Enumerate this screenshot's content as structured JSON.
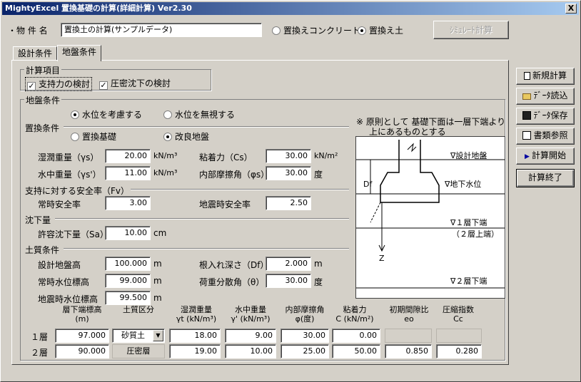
{
  "window": {
    "title": "MightyExcel 置換基礎の計算(詳細計算) Ver2.30",
    "close": "X"
  },
  "header": {
    "name_label": "・物 件 名",
    "name_value": "置換土の計算(サンプルデータ)",
    "radio_concrete": "置換えコンクリート",
    "radio_soil": "置換え土",
    "selected": "置換え土",
    "simulate": "ｼﾐｭﾚｰﾄ計算"
  },
  "tabs": [
    "設計条件",
    "地盤条件"
  ],
  "active_tab": "地盤条件",
  "calc_items": {
    "label": "計算項目",
    "bearing": "支持力の検討",
    "settlement": "圧密沈下の検討"
  },
  "ground": {
    "label": "地盤条件",
    "replace_label": "置換条件",
    "water_consider": "水位を考慮する",
    "water_ignore": "水位を無視する",
    "replace_base": "置換基礎",
    "improved": "改良地盤"
  },
  "params": {
    "gamma_s_label": "湿潤重量（γs）",
    "gamma_s": "20.00",
    "gamma_s_unit": "kN/m³",
    "cs_label": "粘着力（Cs）",
    "cs": "30.00",
    "cs_unit": "kN/m²",
    "gamma_s2_label": "水中重量（γs'）",
    "gamma_s2": "11.00",
    "gamma_s2_unit": "kN/m³",
    "phis_label": "内部摩擦角（φs）",
    "phis": "30.00",
    "phis_unit": "度"
  },
  "safety": {
    "label": "支持に対する安全率（Fv）",
    "normal_label": "常時安全率",
    "normal": "3.00",
    "quake_label": "地震時安全率",
    "quake": "2.50"
  },
  "settle": {
    "label": "沈下量",
    "allow_label": "許容沈下量（Sa）",
    "allow": "10.00",
    "unit": "cm"
  },
  "soil": {
    "label": "土質条件",
    "design_gl_label": "設計地盤高",
    "design_gl": "100.000",
    "m": "m",
    "df_label": "根入れ深さ（Df）",
    "df": "2.000",
    "wl_label": "常時水位標高",
    "wl": "99.000",
    "theta_label": "荷重分散角（θ）",
    "theta": "30.00",
    "deg": "度",
    "qwl_label": "地震時水位標高",
    "qwl": "99.500"
  },
  "table": {
    "headers": [
      [
        "層下端標高",
        "(m)"
      ],
      [
        "土質区分",
        ""
      ],
      [
        "湿潤重量",
        "γt (kN/m³)"
      ],
      [
        "水中重量",
        "γ' (kN/m³)"
      ],
      [
        "内部摩擦角",
        "φ(度)"
      ],
      [
        "粘着力",
        "C (kN/m²)"
      ],
      [
        "初期間隙比",
        "eo"
      ],
      [
        "圧縮指数",
        "Cc"
      ]
    ],
    "rows": [
      {
        "label": "１層",
        "elev": "97.000",
        "type": "砂質土",
        "gt": "18.00",
        "gw": "9.00",
        "phi": "30.00",
        "c": "0.00",
        "eo": "",
        "cc": ""
      },
      {
        "label": "２層",
        "elev": "90.000",
        "type": "圧密層",
        "gt": "19.00",
        "gw": "10.00",
        "phi": "25.00",
        "c": "50.00",
        "eo": "0.850",
        "cc": "0.280"
      }
    ]
  },
  "note": {
    "line1": "※ 原則として 基礎下面は一層下端より",
    "line2": "上にあるものとする"
  },
  "diagram": {
    "design_gl": "∇設計地盤",
    "wl": "∇地下水位",
    "layer1": "∇１層下端",
    "layer1b": "（２層上端）",
    "layer2": "∇２層下端",
    "df": "Df",
    "z": "Z"
  },
  "side_buttons": [
    "新規計算",
    "ﾃﾞｰﾀ読込",
    "ﾃﾞｰﾀ保存",
    "書類参照",
    "計算開始",
    "計算終了"
  ]
}
